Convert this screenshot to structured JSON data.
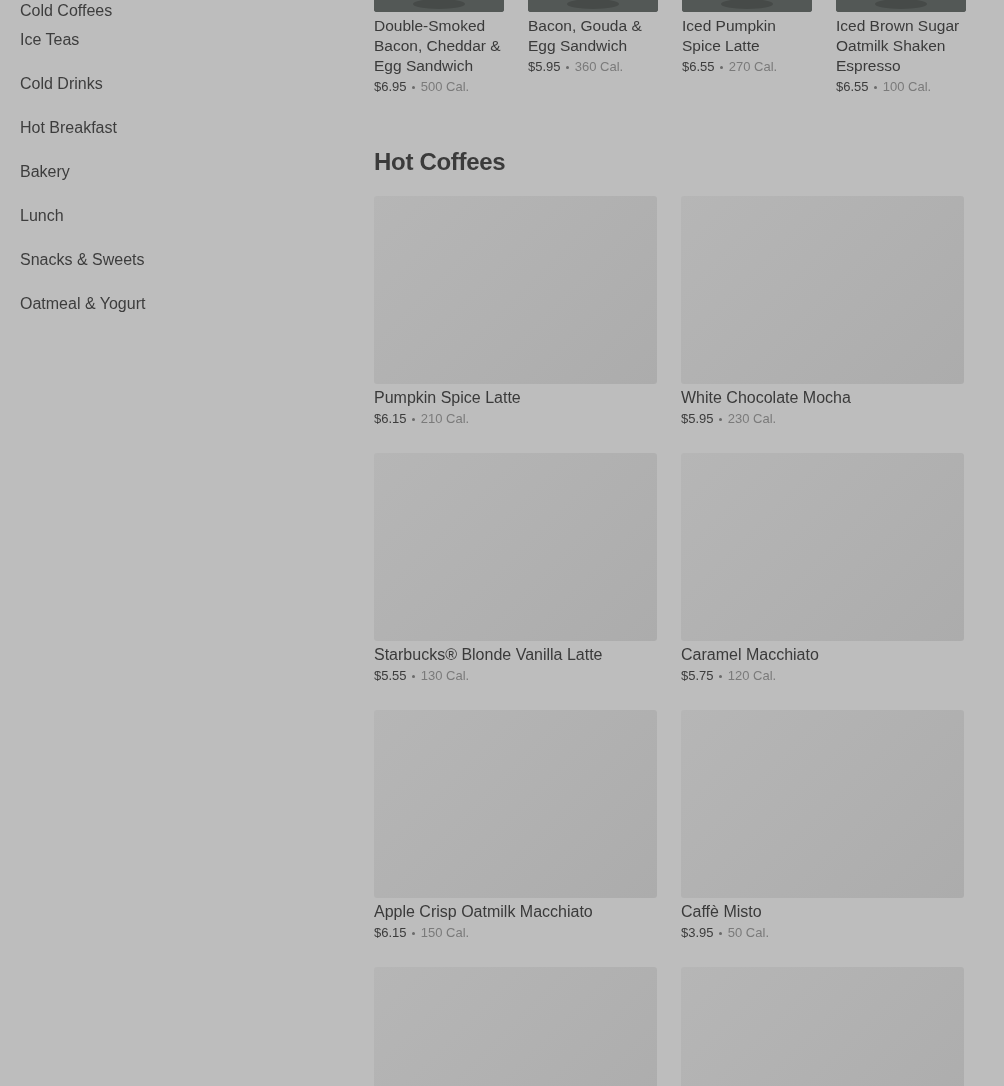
{
  "sidebar": {
    "items": [
      {
        "label": "Cold Coffees"
      },
      {
        "label": "Ice Teas"
      },
      {
        "label": "Cold Drinks"
      },
      {
        "label": "Hot Breakfast"
      },
      {
        "label": "Bakery"
      },
      {
        "label": "Lunch"
      },
      {
        "label": "Snacks & Sweets"
      },
      {
        "label": "Oatmeal & Yogurt"
      }
    ]
  },
  "featured": [
    {
      "name": "Double-Smoked Bacon, Cheddar & Egg Sandwich",
      "price": "$6.95",
      "calories": "500 Cal."
    },
    {
      "name": "Bacon, Gouda & Egg Sandwich",
      "price": "$5.95",
      "calories": "360 Cal."
    },
    {
      "name": "Iced Pumpkin Spice Latte",
      "price": "$6.55",
      "calories": "270 Cal."
    },
    {
      "name": "Iced Brown Sugar Oatmilk Shaken Espresso",
      "price": "$6.55",
      "calories": "100 Cal."
    }
  ],
  "section": {
    "title": "Hot Coffees",
    "products": [
      {
        "kind": "item",
        "name": "Pumpkin Spice Latte",
        "price": "$6.15",
        "calories": "210 Cal."
      },
      {
        "kind": "item",
        "name": "White Chocolate Mocha",
        "price": "$5.95",
        "calories": "230 Cal."
      },
      {
        "kind": "item",
        "name": "Starbucks® Blonde Vanilla Latte",
        "price": "$5.55",
        "calories": "130 Cal."
      },
      {
        "kind": "item",
        "name": "Caramel Macchiato",
        "price": "$5.75",
        "calories": "120 Cal."
      },
      {
        "kind": "item",
        "name": "Apple Crisp Oatmilk Macchiato",
        "price": "$6.15",
        "calories": "150 Cal."
      },
      {
        "kind": "item",
        "name": "Caffè Misto",
        "price": "$3.95",
        "calories": "50 Cal."
      },
      {
        "kind": "cut"
      },
      {
        "kind": "cut"
      }
    ]
  }
}
